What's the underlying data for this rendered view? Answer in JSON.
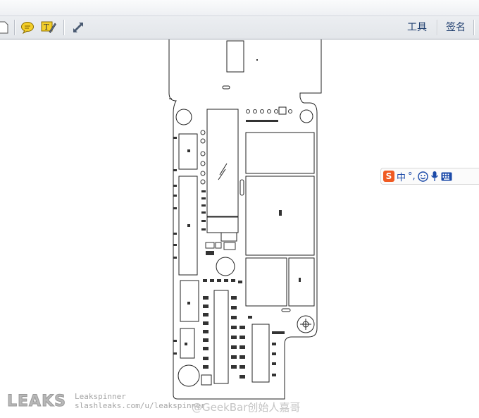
{
  "toolbar": {
    "tools_label": "工具",
    "sign_label": "签名",
    "colors": {
      "accent_text": "#1e3d6e",
      "comment_icon": "#e2b615"
    }
  },
  "icons": [
    "page-icon",
    "comment-icon",
    "highlight-comment-icon",
    "expand-icon",
    "sogou-logo-icon",
    "punctuation-icon",
    "emoji-icon",
    "microphone-icon",
    "keyboard-icon"
  ],
  "ime": {
    "logo": "S",
    "mode": "中",
    "punct": "°,"
  },
  "watermark": {
    "brand": "LEAKS",
    "author": "Leakspinner",
    "url": "slashleaks.com/u/leakspinner",
    "weibo": "@GeekBar创始人嘉哥"
  }
}
